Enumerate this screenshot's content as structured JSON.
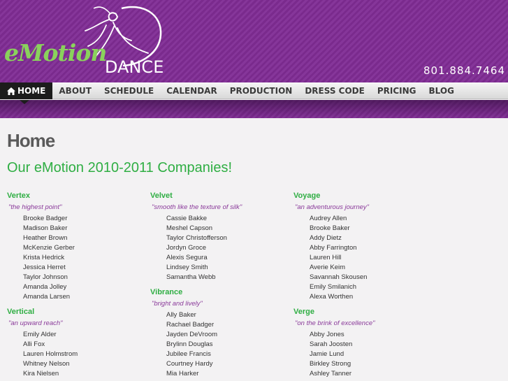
{
  "brand": {
    "logo_word": "eMotion",
    "logo_word2": "DANCE",
    "phone": "801.884.7464",
    "colors": {
      "purple": "#7a2a8d",
      "green": "#2fae43",
      "logo_green": "#8ad25c",
      "motto": "#8a3a9a"
    }
  },
  "nav": {
    "items": [
      {
        "label": "HOME",
        "active": true,
        "icon": "home-icon"
      },
      {
        "label": "ABOUT"
      },
      {
        "label": "SCHEDULE"
      },
      {
        "label": "CALENDAR"
      },
      {
        "label": "PRODUCTION"
      },
      {
        "label": "DRESS CODE"
      },
      {
        "label": "PRICING"
      },
      {
        "label": "BLOG"
      }
    ]
  },
  "page": {
    "title": "Home",
    "heading": "Our eMotion 2010-2011 Companies!"
  },
  "companies": {
    "col1": [
      {
        "name": "Vertex",
        "motto": "\"the highest point\"",
        "members": [
          "Brooke Badger",
          "Madison Baker",
          "Heather Brown",
          "McKenzie Gerber",
          "Krista Hedrick",
          "Jessica Herret",
          "Taylor Johnson",
          "Amanda Jolley",
          "Amanda Larsen"
        ]
      },
      {
        "name": "Vertical",
        "motto": "\"an upward reach\"",
        "members": [
          "Emily Alder",
          "Alli Fox",
          "Lauren Holmstrom",
          "Whitney Nelson",
          "Kira Nielsen"
        ]
      }
    ],
    "col2": [
      {
        "name": "Velvet",
        "motto": "\"smooth like the texture of silk\"",
        "members": [
          "Cassie Bakke",
          "Meshel Capson",
          "Taylor Christofferson",
          "Jordyn Groce",
          "Alexis Segura",
          "Lindsey Smith",
          "Samantha Webb"
        ]
      },
      {
        "name": "Vibrance",
        "motto": "\"bright and lively\"",
        "members": [
          "Ally Baker",
          "Rachael Badger",
          "Jayden DeVroom",
          "Brylinn Douglas",
          "Jubilee Francis",
          "Courtney Hardy",
          "Mia Harker"
        ]
      }
    ],
    "col3": [
      {
        "name": "Voyage",
        "motto": "\"an adventurous journey\"",
        "members": [
          "Audrey Allen",
          "Brooke Baker",
          "Addy Dietz",
          "Abby Farrington",
          "Lauren Hill",
          "Averie Keim",
          "Savannah Skousen",
          "Emily Smilanich",
          "Alexa Worthen"
        ]
      },
      {
        "name": "Verge",
        "motto": "\"on the brink of excellence\"",
        "members": [
          "Abby Jones",
          "Sarah Joosten",
          "Jamie Lund",
          "Birkley Strong",
          "Ashley Tanner"
        ]
      }
    ]
  }
}
